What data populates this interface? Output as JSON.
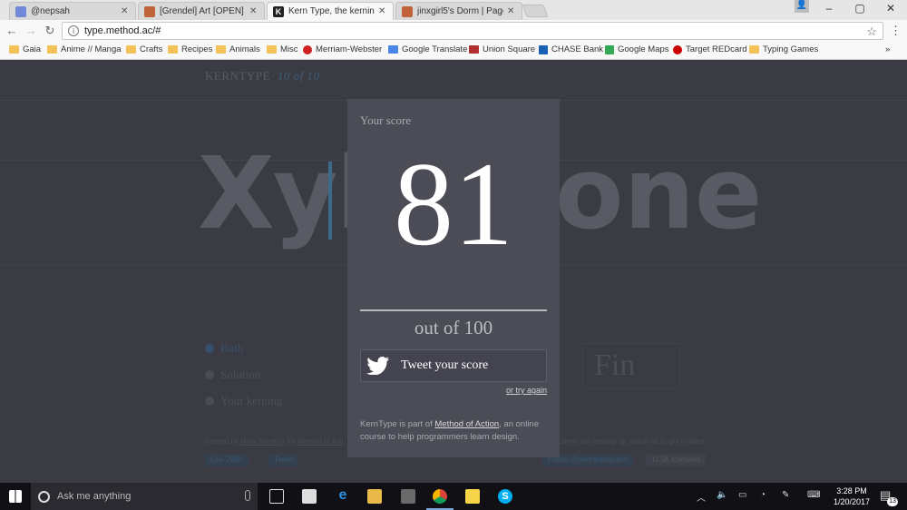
{
  "browser": {
    "tabs": [
      {
        "label": "@nepsah",
        "color": "#7289da"
      },
      {
        "label": "[Grendel] Art [OPEN] | Pa",
        "color": "#c0633b"
      },
      {
        "label": "Kern Type, the kerning g",
        "color": "#222222"
      },
      {
        "label": "jinxgirl5's Dorm | Page 2",
        "color": "#c0633b"
      }
    ],
    "url": "type.method.ac/#",
    "bookmarks": [
      {
        "label": "Gaia",
        "color": "#f3c35a"
      },
      {
        "label": "Anime // Manga",
        "color": "#f3c35a"
      },
      {
        "label": "Crafts",
        "color": "#f3c35a"
      },
      {
        "label": "Recipes",
        "color": "#f3c35a"
      },
      {
        "label": "Animals",
        "color": "#f3c35a"
      },
      {
        "label": "Misc",
        "color": "#f3c35a"
      },
      {
        "label": "Merriam-Webster",
        "color": "#cc2222"
      },
      {
        "label": "Google Translate",
        "color": "#4a86e8"
      },
      {
        "label": "Union Square",
        "color": "#b03030"
      },
      {
        "label": "CHASE Bank",
        "color": "#1a5fb4"
      },
      {
        "label": "Google Maps",
        "color": "#34a853"
      },
      {
        "label": "Target REDcard",
        "color": "#cc0000"
      },
      {
        "label": "Typing Games",
        "color": "#f3c35a"
      }
    ],
    "more_bookmarks": "»"
  },
  "game": {
    "brand": "KERNTYPE",
    "progress": "10 of 10",
    "word_left": "Xyl",
    "word_right": "one",
    "options": [
      {
        "label": "Both",
        "selected": true
      },
      {
        "label": "Solution",
        "selected": false
      },
      {
        "label": "Your kerning",
        "selected": false
      }
    ],
    "finish_button": "Fin",
    "credit_prefix": "Crafted by",
    "credit_author": "Mark MacKay",
    "credit_for": "for",
    "credit_org": "Method of Acti",
    "newsletter": "ames are coming up, follow us to get notified",
    "like_button": "Like 298K",
    "tweet_button": "Tweet",
    "follow_button": "Follow @methodofaction",
    "followers": "11.5K followers"
  },
  "modal": {
    "label": "Your score",
    "score": "81",
    "out_of": "out of 100",
    "tweet_label": "Tweet your score",
    "try_again": "or try again",
    "about_prefix": "KernType is part of",
    "about_link": "Method of Action",
    "about_suffix": ", an online course to help programmers learn design."
  },
  "taskbar": {
    "search_placeholder": "Ask me anything",
    "time": "3:28 PM",
    "date": "1/20/2017",
    "notifications": "13"
  }
}
